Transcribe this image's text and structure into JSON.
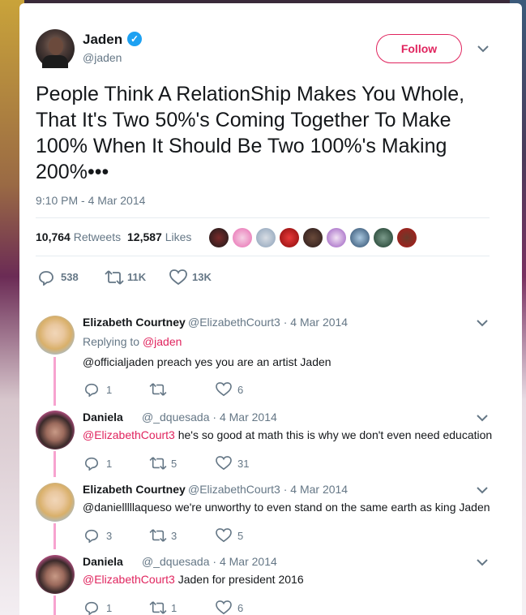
{
  "tweet": {
    "author_name": "Jaden",
    "author_handle": "@jaden",
    "follow_label": "Follow",
    "text": "People Think A RelationShip Makes You Whole, That It's Two 50%'s Coming Together To Make 100% When It Should Be Two 100%'s Making 200%•••",
    "timestamp": "9:10 PM - 4 Mar 2014",
    "retweets_count": "10,764",
    "retweets_label": "Retweets",
    "likes_count": "12,587",
    "likes_label": "Likes",
    "replies_action": "538",
    "retweets_action": "11K",
    "likes_action": "13K"
  },
  "colors": {
    "accent": "#e0245e",
    "verified": "#1da1f2",
    "muted": "#657786",
    "thread": "#f7a3cf"
  },
  "replies": [
    {
      "name": "Elizabeth Courtney",
      "handle": "@ElizabethCourt3",
      "date": "· 4 Mar 2014",
      "replying_prefix": "Replying to",
      "replying_to": "@jaden",
      "mention": "",
      "text": "@officialjaden preach yes you are an artist Jaden",
      "replies": "1",
      "retweets": "",
      "likes": "6"
    },
    {
      "name": "Daniela",
      "handle": "@_dquesada",
      "date": "· 4 Mar 2014",
      "mention": "@ElizabethCourt3",
      "text": " he's so good at math this is why we don't even need education",
      "replies": "1",
      "retweets": "5",
      "likes": "31"
    },
    {
      "name": "Elizabeth Courtney",
      "handle": "@ElizabethCourt3",
      "date": "· 4 Mar 2014",
      "mention": "",
      "text": "@danielllllaqueso we're unworthy to even stand on the same earth as king Jaden",
      "replies": "3",
      "retweets": "3",
      "likes": "5"
    },
    {
      "name": "Daniela",
      "handle": "@_dquesada",
      "date": "· 4 Mar 2014",
      "mention": "@ElizabethCourt3",
      "text": " Jaden for president 2016",
      "replies": "1",
      "retweets": "1",
      "likes": "6"
    }
  ]
}
